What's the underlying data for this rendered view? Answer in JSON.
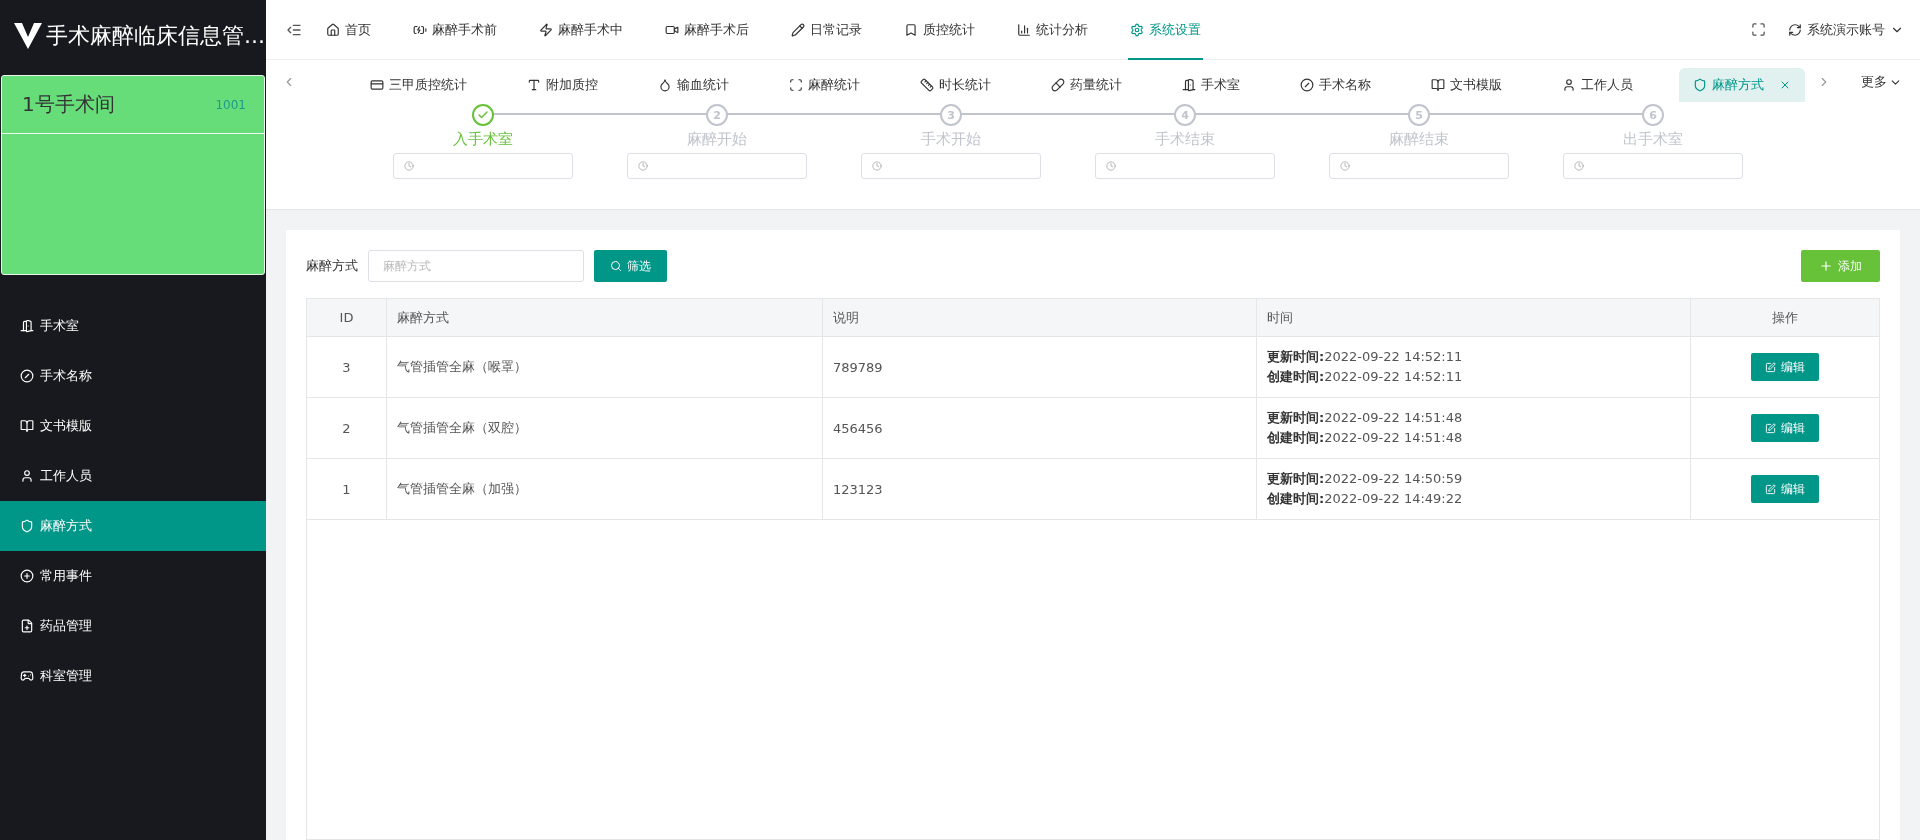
{
  "app": {
    "title": "手术麻醉临床信息管..."
  },
  "room": {
    "name": "1号手术间",
    "code": "1001"
  },
  "sidebar": {
    "items": [
      {
        "label": "手术室",
        "selected": false
      },
      {
        "label": "手术名称",
        "selected": false
      },
      {
        "label": "文书模版",
        "selected": false
      },
      {
        "label": "工作人员",
        "selected": false
      },
      {
        "label": "麻醉方式",
        "selected": true
      },
      {
        "label": "常用事件",
        "selected": false
      },
      {
        "label": "药品管理",
        "selected": false
      },
      {
        "label": "科室管理",
        "selected": false
      }
    ]
  },
  "top_nav": {
    "items": [
      {
        "label": "首页",
        "selected": false
      },
      {
        "label": "麻醉手术前",
        "selected": false
      },
      {
        "label": "麻醉手术中",
        "selected": false
      },
      {
        "label": "麻醉手术后",
        "selected": false
      },
      {
        "label": "日常记录",
        "selected": false
      },
      {
        "label": "质控统计",
        "selected": false
      },
      {
        "label": "统计分析",
        "selected": false
      },
      {
        "label": "系统设置",
        "selected": true
      }
    ],
    "account": "系统演示账号"
  },
  "tabs": {
    "items": [
      {
        "label": "三甲质控统计",
        "selected": false
      },
      {
        "label": "附加质控",
        "selected": false
      },
      {
        "label": "输血统计",
        "selected": false
      },
      {
        "label": "麻醉统计",
        "selected": false
      },
      {
        "label": "时长统计",
        "selected": false
      },
      {
        "label": "药量统计",
        "selected": false
      },
      {
        "label": "手术室",
        "selected": false
      },
      {
        "label": "手术名称",
        "selected": false
      },
      {
        "label": "文书模版",
        "selected": false
      },
      {
        "label": "工作人员",
        "selected": false
      },
      {
        "label": "麻醉方式",
        "selected": true
      }
    ],
    "more": "更多"
  },
  "steps": [
    {
      "label": "入手术室",
      "done": true
    },
    {
      "label": "麻醉开始",
      "done": false,
      "number": "2"
    },
    {
      "label": "手术开始",
      "done": false,
      "number": "3"
    },
    {
      "label": "手术结束",
      "done": false,
      "number": "4"
    },
    {
      "label": "麻醉结束",
      "done": false,
      "number": "5"
    },
    {
      "label": "出手术室",
      "done": false,
      "number": "6"
    }
  ],
  "filter": {
    "label": "麻醉方式",
    "placeholder": "麻醉方式",
    "button": "筛选"
  },
  "add_button": "添加",
  "table": {
    "columns": [
      "ID",
      "麻醉方式",
      "说明",
      "时间",
      "操作"
    ],
    "rows": [
      {
        "id": "3",
        "method": "气管插管全麻（喉罩）",
        "note": "789789",
        "updated": "**更新时间:**2022-09-22 14:52:11",
        "created": "**创建时间:**2022-09-22 14:52:11",
        "action": "编辑"
      },
      {
        "id": "2",
        "method": "气管插管全麻（双腔）",
        "note": "456456",
        "updated": "**更新时间:**2022-09-22 14:51:48",
        "created": "**创建时间:**2022-09-22 14:51:48",
        "action": "编辑"
      },
      {
        "id": "1",
        "method": "气管插管全麻（加强）",
        "note": "123123",
        "updated": "**更新时间:**2022-09-22 14:50:59",
        "created": "**创建时间:**2022-09-22 14:49:22",
        "action": "编辑"
      }
    ]
  }
}
